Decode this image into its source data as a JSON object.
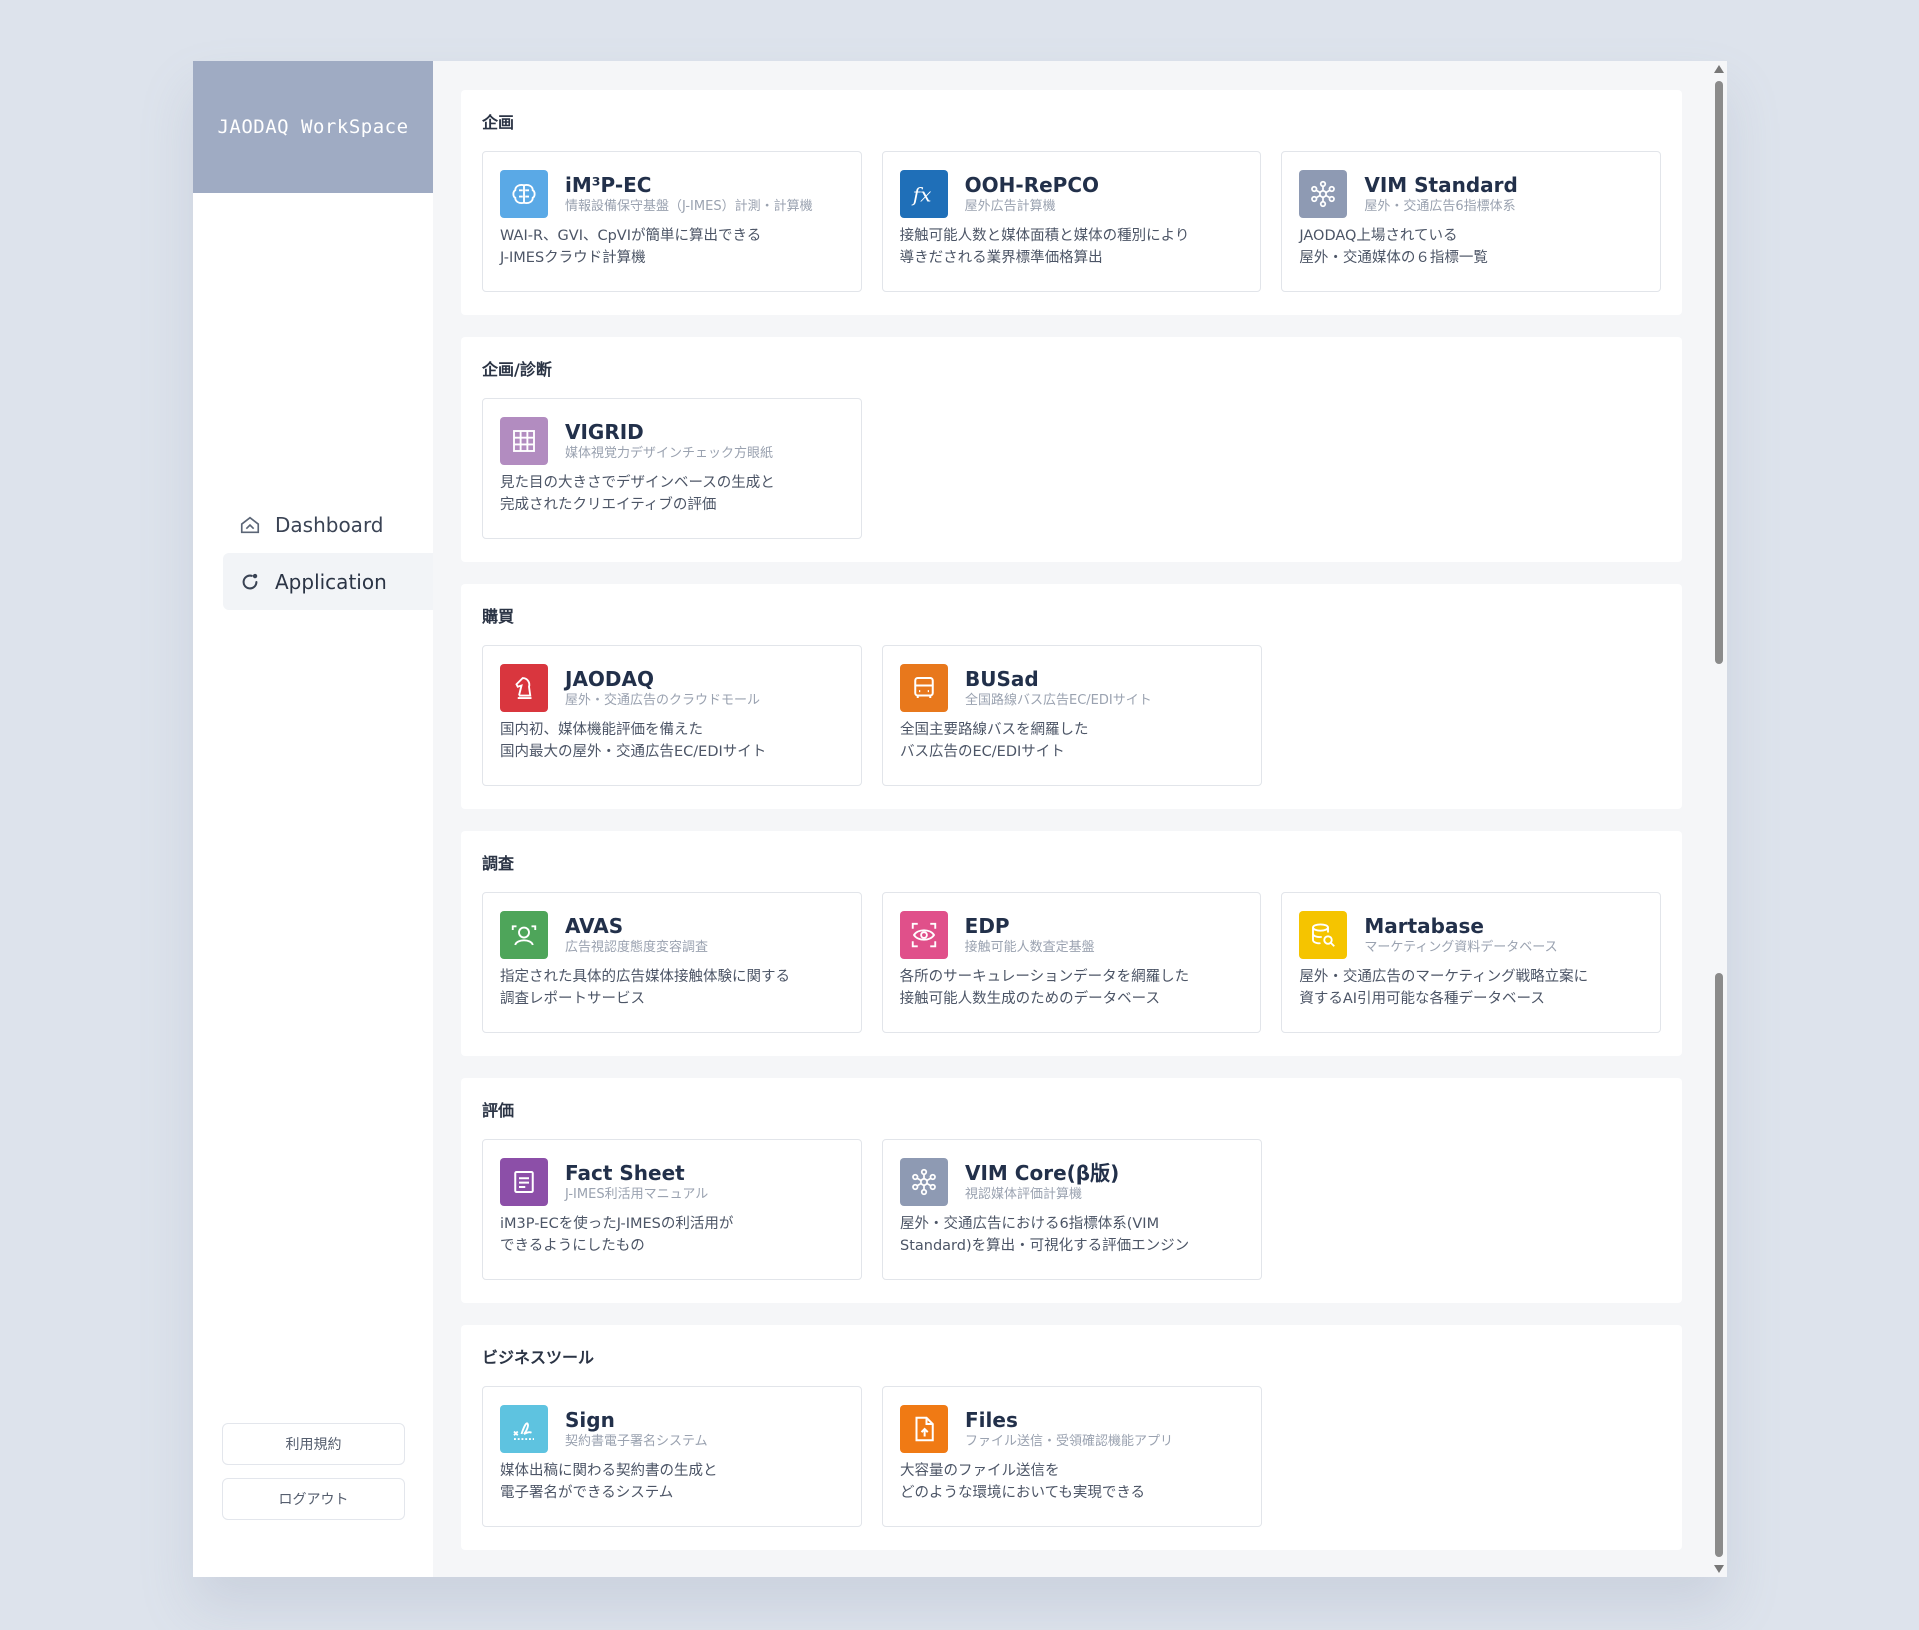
{
  "brand": "JAODAQ WorkSpace",
  "nav": [
    {
      "label": "Dashboard",
      "icon": "home-icon",
      "active": false
    },
    {
      "label": "Application",
      "icon": "refresh-icon",
      "active": true
    }
  ],
  "footer": {
    "terms": "利用規約",
    "logout": "ログアウト"
  },
  "sections": [
    {
      "title": "企画",
      "apps": [
        {
          "title": "iM³P-EC",
          "subtitle": "情報設備保守基盤（J-IMES）計測・計算機",
          "desc": "WAI-R、GVI、CpVIが簡単に算出できる\nJ-IMESクラウド計算機",
          "color": "#5aa9e6",
          "icon": "brain-icon"
        },
        {
          "title": "OOH-RePCO",
          "subtitle": "屋外広告計算機",
          "desc": "接触可能人数と媒体面積と媒体の種別により\n導きだされる業界標準価格算出",
          "color": "#1f6fb8",
          "icon": "function-icon"
        },
        {
          "title": "VIM Standard",
          "subtitle": "屋外・交通広告6指標体系",
          "desc": "JAODAQ上場されている\n屋外・交通媒体の６指標一覧",
          "color": "#8e9ab3",
          "icon": "molecule-icon"
        }
      ]
    },
    {
      "title": "企画/診断",
      "apps": [
        {
          "title": "VIGRID",
          "subtitle": "媒体視覚力デザインチェック方眼紙",
          "desc": "見た目の大きさでデザインベースの生成と\n完成されたクリエイティブの評価",
          "color": "#b28cc0",
          "icon": "grid-icon"
        }
      ]
    },
    {
      "title": "購買",
      "apps": [
        {
          "title": "JAODAQ",
          "subtitle": "屋外・交通広告のクラウドモール",
          "desc": "国内初、媒体機能評価を備えた\n国内最大の屋外・交通広告EC/EDIサイト",
          "color": "#d9363e",
          "icon": "chess-knight-icon"
        },
        {
          "title": "BUSad",
          "subtitle": "全国路線バス広告EC/EDIサイト",
          "desc": "全国主要路線バスを網羅した\nバス広告のEC/EDIサイト",
          "color": "#e8781c",
          "icon": "bus-icon"
        }
      ]
    },
    {
      "title": "調査",
      "apps": [
        {
          "title": "AVAS",
          "subtitle": "広告視認度態度変容調査",
          "desc": "指定された具体的広告媒体接触体験に関する\n調査レポートサービス",
          "color": "#4ea55a",
          "icon": "person-scan-icon"
        },
        {
          "title": "EDP",
          "subtitle": "接触可能人数査定基盤",
          "desc": "各所のサーキュレーションデータを網羅した\n接触可能人数生成のためのデータベース",
          "color": "#e0508a",
          "icon": "eye-scan-icon"
        },
        {
          "title": "Martabase",
          "subtitle": "マーケティング資料データベース",
          "desc": "屋外・交通広告のマーケティング戦略立案に\n資するAI引用可能な各種データベース",
          "color": "#f5c400",
          "icon": "database-search-icon"
        }
      ]
    },
    {
      "title": "評価",
      "apps": [
        {
          "title": "Fact Sheet",
          "subtitle": "J-IMES利活用マニュアル",
          "desc": "iM3P-ECを使ったJ-IMESの利活用が\nできるようにしたもの",
          "color": "#8c4fa8",
          "icon": "document-icon"
        },
        {
          "title": "VIM Core(β版)",
          "subtitle": "視認媒体評価計算機",
          "desc": "屋外・交通広告における6指標体系(VIM\nStandard)を算出・可視化する評価エンジン",
          "color": "#8e9ab3",
          "icon": "molecule-icon"
        }
      ]
    },
    {
      "title": "ビジネスツール",
      "apps": [
        {
          "title": "Sign",
          "subtitle": "契約書電子署名システム",
          "desc": "媒体出稿に関わる契約書の生成と\n電子署名ができるシステム",
          "color": "#5ec3e0",
          "icon": "signature-icon"
        },
        {
          "title": "Files",
          "subtitle": "ファイル送信・受領確認機能アプリ",
          "desc": "大容量のファイル送信を\nどのような環境においても実現できる",
          "color": "#f07a14",
          "icon": "file-upload-icon"
        }
      ]
    }
  ]
}
